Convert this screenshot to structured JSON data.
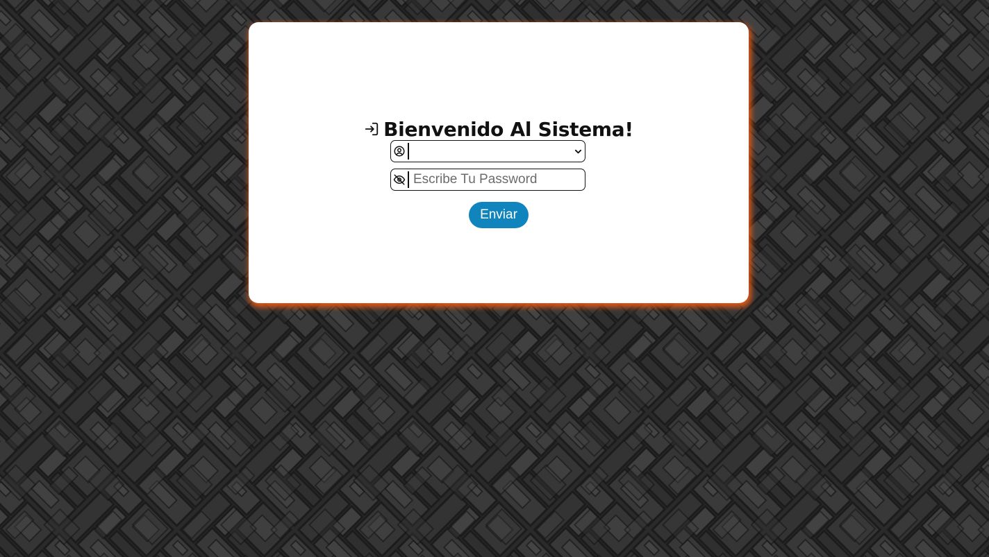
{
  "login": {
    "title": "Bienvenido Al Sistema!",
    "title_icon": "login-icon",
    "user_select": {
      "icon": "user-circle-icon",
      "selected_value": ""
    },
    "password": {
      "icon": "eye-off-icon",
      "placeholder": "Escribe Tu Password",
      "value": ""
    },
    "submit_label": "Enviar"
  },
  "colors": {
    "card_glow": "#e85814",
    "button": "#0f84bd",
    "background": "#2c2c2c"
  }
}
